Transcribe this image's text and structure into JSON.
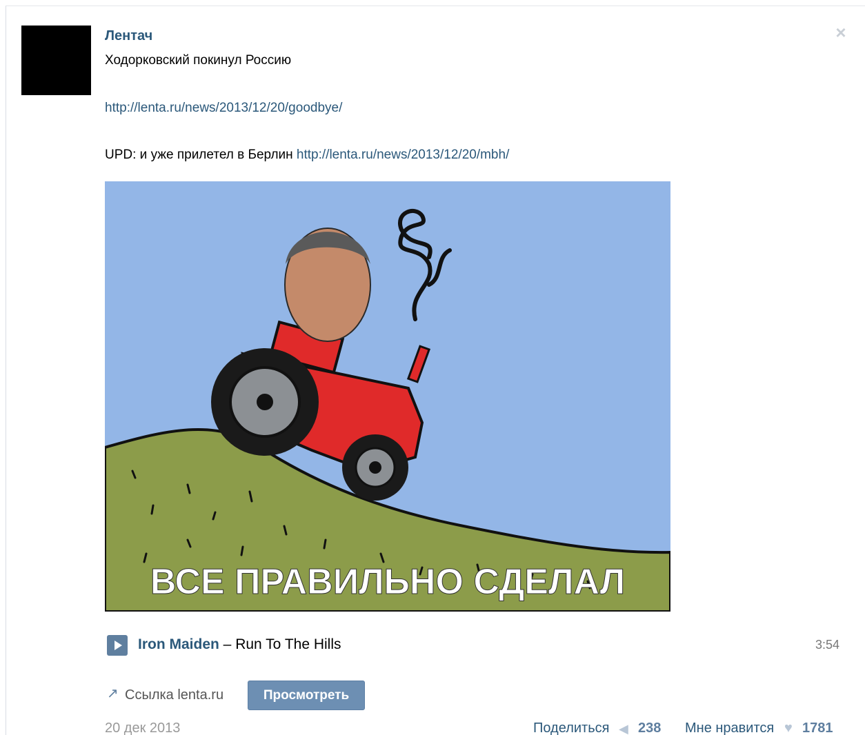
{
  "post": {
    "author": "Лентач",
    "text_line1": "Ходорковский покинул Россию",
    "link1": "http://lenta.ru/news/2013/12/20/goodbye/",
    "upd_prefix": "UPD: и уже прилетел в Берлин",
    "link2": "http://lenta.ru/news/2013/12/20/mbh/",
    "image_caption": "ВСЕ ПРАВИЛЬНО СДЕЛАЛ",
    "date": "20 дек 2013",
    "close_icon": "close-icon"
  },
  "audio": {
    "artist": "Iron Maiden",
    "separator": " – ",
    "title": "Run To The Hills",
    "duration": "3:54"
  },
  "attachment": {
    "link_label": "Ссылка lenta.ru",
    "view_button": "Просмотреть",
    "icon": "link-arrow-icon"
  },
  "footer": {
    "share_label": "Поделиться",
    "share_count": "238",
    "like_label": "Мне нравится",
    "like_count": "1781"
  },
  "colors": {
    "link": "#2b587a",
    "sky": "#93b6e7",
    "hill": "#8c9c4a",
    "tractor": "#e02a2a",
    "button": "#6d8fb3"
  }
}
